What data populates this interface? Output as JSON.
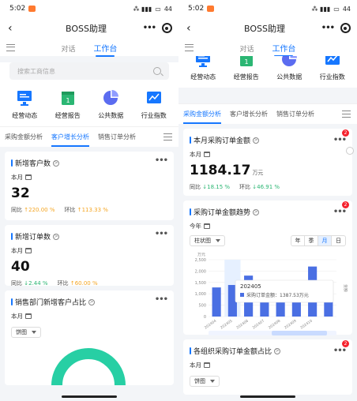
{
  "status_time": "5:02",
  "battery": "44",
  "nav_title": "BOSS助理",
  "top_tabs": [
    "对话",
    "工作台"
  ],
  "search_placeholder": "搜索工商信息",
  "quick_icons": [
    {
      "label": "经营动态",
      "icon": "monitor-icon"
    },
    {
      "label": "经营报告",
      "icon": "calendar-report-icon"
    },
    {
      "label": "公共数据",
      "icon": "pie-icon"
    },
    {
      "label": "行业指数",
      "icon": "trend-icon"
    }
  ],
  "left_sub_tabs": [
    "采购金额分析",
    "客户增长分析",
    "销售订单分析"
  ],
  "right_sub_tabs": [
    "采购金额分析",
    "客户增长分析",
    "销售订单分析"
  ],
  "left": {
    "card1": {
      "title": "新增客户数",
      "period": "本月",
      "value": "32",
      "yoy_label": "同比",
      "yoy": "220.00 %",
      "mom_label": "环比",
      "mom": "113.33 %"
    },
    "card2": {
      "title": "新增订单数",
      "period": "本月",
      "value": "40",
      "yoy_label": "同比",
      "yoy": "2.44 %",
      "mom_label": "环比",
      "mom": "60.00 %"
    },
    "card3": {
      "title": "销售部门新增客户占比",
      "period": "本月",
      "select": "饼图"
    }
  },
  "right": {
    "card1": {
      "title": "本月采购订单金额",
      "period": "本月",
      "value": "1184.17",
      "unit": "万元",
      "yoy_label": "同比",
      "yoy": "18.15 %",
      "mom_label": "环比",
      "mom": "46.91 %",
      "badge": "2"
    },
    "card2": {
      "title": "采购订单金额趋势",
      "period": "今年",
      "select": "柱状图",
      "badge": "2",
      "segments": [
        "年",
        "季",
        "月",
        "日"
      ],
      "active_segment": "月"
    },
    "card3": {
      "title": "各组织采购订单金额占比",
      "period": "本月",
      "select": "饼图",
      "badge": "2"
    }
  },
  "chart_data": {
    "type": "bar",
    "ylabel": "万元",
    "right_label": "金额",
    "ylim": [
      0,
      2500
    ],
    "yticks": [
      "2,500",
      "2,000",
      "1,500",
      "1,000",
      "500",
      "0"
    ],
    "categories": [
      "202404",
      "202405",
      "202406",
      "202407",
      "202408",
      "202409",
      "202410",
      "202411"
    ],
    "x_tick_labels": [
      "202404",
      "202405",
      "202406",
      "202407",
      "202408",
      "202409",
      "202410"
    ],
    "values": [
      1280,
      1387.53,
      1800,
      950,
      1000,
      1220,
      2200,
      1184.17
    ],
    "highlight_index": 1,
    "tooltip": {
      "title": "202405",
      "series": "采购订单金额",
      "value": "1387.53万元"
    },
    "color": "#4a6fe3"
  }
}
